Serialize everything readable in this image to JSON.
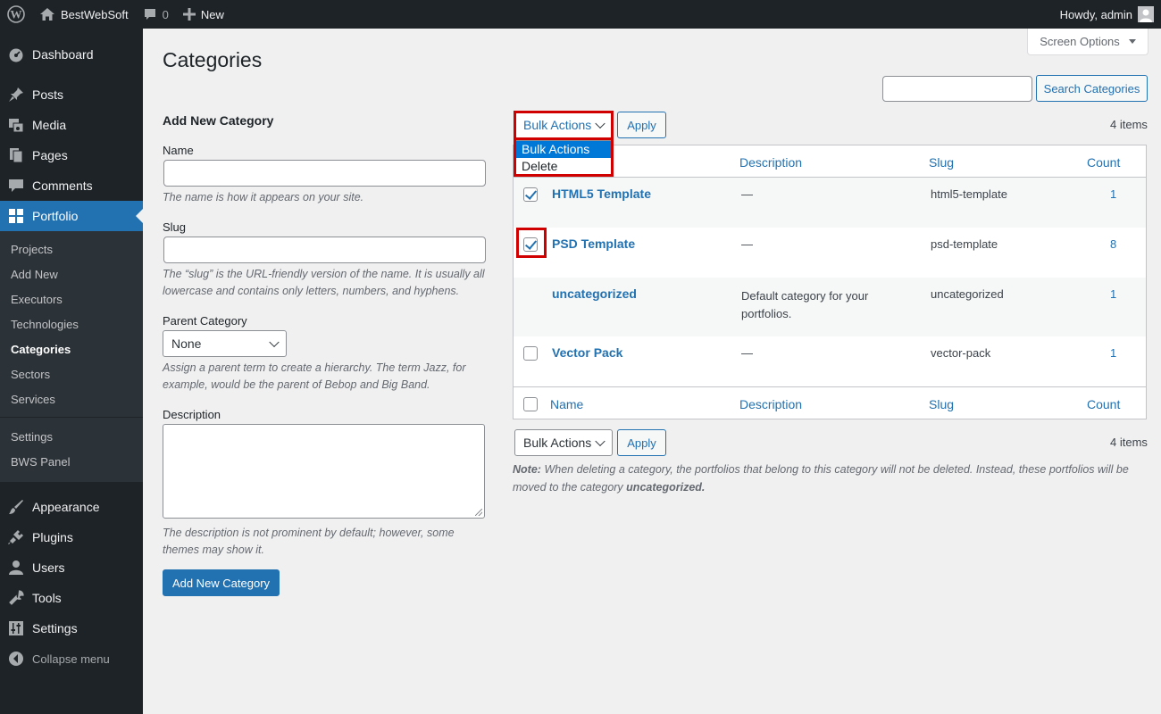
{
  "adminbar": {
    "site_name": "BestWebSoft",
    "comments_count": "0",
    "new_label": "New",
    "greeting": "Howdy, admin"
  },
  "sidebar": {
    "items": [
      {
        "label": "Dashboard",
        "icon": "dashboard-icon"
      },
      {
        "label": "Posts",
        "icon": "pin-icon"
      },
      {
        "label": "Media",
        "icon": "media-icon"
      },
      {
        "label": "Pages",
        "icon": "pages-icon"
      },
      {
        "label": "Comments",
        "icon": "comments-icon"
      },
      {
        "label": "Portfolio",
        "icon": "grid-icon",
        "active": true
      }
    ],
    "submenu": [
      "Projects",
      "Add New",
      "Executors",
      "Technologies",
      "Categories",
      "Sectors",
      "Services",
      "Settings",
      "BWS Panel"
    ],
    "submenu_current": "Categories",
    "lower_items": [
      {
        "label": "Appearance",
        "icon": "brush-icon"
      },
      {
        "label": "Plugins",
        "icon": "plug-icon"
      },
      {
        "label": "Users",
        "icon": "users-icon"
      },
      {
        "label": "Tools",
        "icon": "wrench-icon"
      },
      {
        "label": "Settings",
        "icon": "settings-sliders-icon"
      }
    ],
    "collapse_label": "Collapse menu"
  },
  "page": {
    "title": "Categories",
    "screen_options": "Screen Options",
    "search_button": "Search Categories",
    "search_value": ""
  },
  "form": {
    "heading": "Add New Category",
    "name_label": "Name",
    "name_value": "",
    "name_help": "The name is how it appears on your site.",
    "slug_label": "Slug",
    "slug_value": "",
    "slug_help": "The “slug” is the URL-friendly version of the name. It is usually all lowercase and contains only letters, numbers, and hyphens.",
    "parent_label": "Parent Category",
    "parent_value": "None",
    "parent_help": "Assign a parent term to create a hierarchy. The term Jazz, for example, would be the parent of Bebop and Big Band.",
    "description_label": "Description",
    "description_value": "",
    "description_help": "The description is not prominent by default; however, some themes may show it.",
    "submit_label": "Add New Category"
  },
  "bulk": {
    "top_select": "Bulk Actions",
    "bottom_select": "Bulk Actions",
    "apply_label": "Apply",
    "items_count": "4 items",
    "dropdown_options": [
      "Bulk Actions",
      "Delete"
    ],
    "dropdown_selected": "Bulk Actions"
  },
  "table": {
    "columns": [
      "Name",
      "Description",
      "Slug",
      "Count"
    ],
    "rows": [
      {
        "name": "HTML5 Template",
        "description": "—",
        "slug": "html5-template",
        "count": "1",
        "checked": true,
        "has_checkbox": true
      },
      {
        "name": "PSD Template",
        "description": "—",
        "slug": "psd-template",
        "count": "8",
        "checked": true,
        "has_checkbox": true
      },
      {
        "name": "uncategorized",
        "description": "Default category for your portfolios.",
        "slug": "uncategorized",
        "count": "1",
        "checked": false,
        "has_checkbox": false
      },
      {
        "name": "Vector Pack",
        "description": "—",
        "slug": "vector-pack",
        "count": "1",
        "checked": false,
        "has_checkbox": true
      }
    ]
  },
  "note": {
    "label": "Note:",
    "text": "When deleting a category, the portfolios that belong to this category will not be deleted. Instead, these portfolios will be moved to the category",
    "emphasis": "uncategorized."
  },
  "colors": {
    "accent": "#2271b1",
    "admin_dark": "#1d2327",
    "highlight": "#d00000",
    "dropdown_selected": "#0078d7"
  }
}
